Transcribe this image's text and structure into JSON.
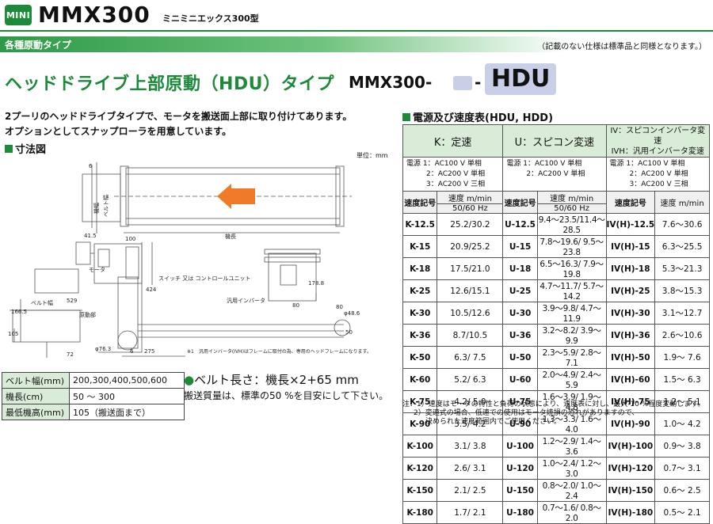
{
  "header": {
    "badge": "MINI",
    "model": "MMX300",
    "model_sub": "ミニミニエックス300型"
  },
  "section_bar": {
    "title": "各種原動タイプ",
    "note": "（記載のない仕様は標準品と同様となります。）"
  },
  "headline": {
    "text": "ヘッドドライブ上部原動（HDU）タイプ",
    "code_model": "MMX300-",
    "code_dash": "-",
    "code_suffix": "HDU"
  },
  "description": {
    "line1": "2プーリのヘッドドライブタイプで、モータを搬送面上部に取り付けてあります。",
    "line2": "オプションとしてスナップローラを用意しています。"
  },
  "dimension": {
    "title": "寸法図",
    "unit": "単位：mm",
    "labels": {
      "belt_width": "ベルト幅",
      "machine_width": "機幅",
      "machine_length": "機長",
      "motor": "モータ",
      "drive": "原動部",
      "switch": "スイッチ 又は コントロールユニット",
      "inverter": "汎用インバータ",
      "footnote": "※1　汎用インバータ(IVH)はフレームに取付の為、専用のヘッドフレームになります。",
      "d6": "6",
      "d41_5": "41.5",
      "d100": "100",
      "d529": "529",
      "d424": "424",
      "d178_8": "178.8",
      "d166_5": "166.5",
      "d105": "105",
      "d80a": "80",
      "d80b": "80",
      "d48_6": "φ48.6",
      "d50": "50",
      "d76_3": "φ76.3",
      "d275": "275",
      "d72": "72",
      "d6b": "6"
    }
  },
  "spec_table": {
    "rows": [
      {
        "label": "ベルト幅(mm)",
        "value": "200,300,400,500,600"
      },
      {
        "label": "機長(cm)",
        "value": "50 ～ 300"
      },
      {
        "label": "最低機高(mm)",
        "value": "105（搬送面まで）"
      }
    ]
  },
  "belt_length": {
    "bullet": "●",
    "text": "ベルト長さ：機長×2+65 mm",
    "note": "搬送質量は、標準の50 %を目安にして下さい。"
  },
  "speed_table": {
    "title": "電源及び速度表(HDU, HDD)",
    "headers": [
      "K：定速",
      "U：スピコン変速",
      "IV：スピコンインバータ変速",
      "IVH：汎用インバータ変速"
    ],
    "power": {
      "k": [
        "電源 1：AC100 V 単相",
        "2：AC200 V 単相",
        "3：AC200 V 三相"
      ],
      "u": [
        "電源 1：AC100 V 単相",
        "2：AC200 V 単相"
      ],
      "iv": [
        "電源 1：AC100 V 単相",
        "2：AC200 V 単相",
        "3：AC200 V 三相"
      ]
    },
    "col_headers": {
      "code": "速度記号",
      "speed": "速度 m/min",
      "hz": "50/60 Hz"
    },
    "rows": [
      {
        "k": "K-12.5",
        "ks": "25.2/30.2",
        "u": "U-12.5",
        "us": "9.4～23.5/11.4～28.5",
        "iv": "IV(H)-12.5",
        "ivs": "7.6～30.6"
      },
      {
        "k": "K-15",
        "ks": "20.9/25.2",
        "u": "U-15",
        "us": "7.8～19.6/ 9.5～23.8",
        "iv": "IV(H)-15",
        "ivs": "6.3～25.5"
      },
      {
        "k": "K-18",
        "ks": "17.5/21.0",
        "u": "U-18",
        "us": "6.5～16.3/ 7.9～19.8",
        "iv": "IV(H)-18",
        "ivs": "5.3～21.3"
      },
      {
        "k": "K-25",
        "ks": "12.6/15.1",
        "u": "U-25",
        "us": "4.7～11.7/ 5.7～14.2",
        "iv": "IV(H)-25",
        "ivs": "3.8～15.3"
      },
      {
        "k": "K-30",
        "ks": "10.5/12.6",
        "u": "U-30",
        "us": "3.9～9.8/ 4.7～11.9",
        "iv": "IV(H)-30",
        "ivs": "3.1～12.7"
      },
      {
        "k": "K-36",
        "ks": "8.7/10.5",
        "u": "U-36",
        "us": "3.2～8.2/ 3.9～9.9",
        "iv": "IV(H)-36",
        "ivs": "2.6～10.6"
      },
      {
        "k": "K-50",
        "ks": "6.3/ 7.5",
        "u": "U-50",
        "us": "2.3～5.9/ 2.8～7.1",
        "iv": "IV(H)-50",
        "ivs": "1.9～ 7.6"
      },
      {
        "k": "K-60",
        "ks": "5.2/ 6.3",
        "u": "U-60",
        "us": "2.0～4.9/ 2.4～5.9",
        "iv": "IV(H)-60",
        "ivs": "1.5～ 6.3"
      },
      {
        "k": "K-75",
        "ks": "4.2/ 5.0",
        "u": "U-75",
        "us": "1.6～3.9/ 1.9～4.8",
        "iv": "IV(H)-75",
        "ivs": "1.2～ 5.1"
      },
      {
        "k": "K-90",
        "ks": "3.5/ 4.2",
        "u": "U-90",
        "us": "1.3～3.3/ 1.6～4.0",
        "iv": "IV(H)-90",
        "ivs": "1.0～ 4.2"
      },
      {
        "k": "K-100",
        "ks": "3.1/ 3.8",
        "u": "U-100",
        "us": "1.2～2.9/ 1.4～3.6",
        "iv": "IV(H)-100",
        "ivs": "0.9～ 3.8"
      },
      {
        "k": "K-120",
        "ks": "2.6/ 3.1",
        "u": "U-120",
        "us": "1.0～2.4/ 1.2～3.0",
        "iv": "IV(H)-120",
        "ivs": "0.7～ 3.1"
      },
      {
        "k": "K-150",
        "ks": "2.1/ 2.5",
        "u": "U-150",
        "us": "0.8～2.0/ 1.0～2.4",
        "iv": "IV(H)-150",
        "ivs": "0.6～ 2.5"
      },
      {
        "k": "K-180",
        "ks": "1.7/ 2.1",
        "u": "U-180",
        "us": "0.7～1.6/ 0.8～2.0",
        "iv": "IV(H)-180",
        "ivs": "0.5～ 2.1"
      }
    ],
    "notes": [
      "注：1）速度はモータの特性と負荷の状態により、速度表に対し、最大-10 %程度変動します。",
      "2）変速式の場合、低速での使用はモータ焼損の恐れがありますので、",
      "決められた速度範囲内でご使用ください。"
    ]
  },
  "colors": {
    "accent": "#1d8a3a",
    "header_fill": "#d9ecd8",
    "arrow": "#f07a2a",
    "code_box": "#c8cfe6"
  }
}
